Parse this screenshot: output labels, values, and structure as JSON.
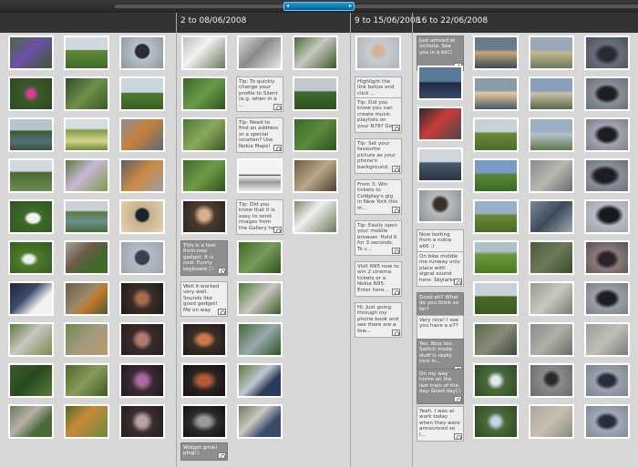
{
  "timeline": {
    "weeks": [
      {
        "label": "2 to 08/06/2008"
      },
      {
        "label": "9 to 15/06/2008"
      },
      {
        "label": "16 to 22/06/2008"
      }
    ],
    "scrubber": {
      "left_arrow": "◂",
      "right_arrow": "▸"
    }
  },
  "messages": {
    "w1": [
      "Tip: To quickly change your profile to Silent (e.g. when in a ...",
      "Tip: Need to find an address or a special location? Use Nokia Maps!",
      "Tip: Did you know that it is easy to send images from the Gallery to a ...",
      "This is a test from new gadget. It is cool. Funny keyboard ☐",
      "Well it worked very well. Sounds like good gadget! Me on way home fo...",
      "Widget gmail ping☐"
    ],
    "w2": [
      "Highlight the link below and click ...",
      "Tip: Did you know you can create music playlists on your N78? Go ...",
      "Tip: Set your favourite picture as your phone's background. Sele...",
      "From 3: Win tickets to Coldplay's gig in New York this m...",
      "Tip: Easily open your mobile browser. Hold 0 for 3 seconds. To c...",
      "Visit N95 now to win 2 cinema tickets or a Nokia N95. Enter here...",
      "Hi. Just going through my phone book and see there are a few..."
    ],
    "w3": [
      "Just arrived at victoria. See you in a bit☐",
      "Now texting from a nokia e66 :)",
      "On bike middle me runway only place with signal sound here. Skylarks sin...",
      "Good eh? What do you think so far?",
      "Very nice! I see you have a e7?",
      "Yes. Nice too. Switch mode stuff is really nice in...",
      "On my way home on the last train of the day. Good day☐",
      "Yeah. I was at work today when they were announced so I..."
    ]
  }
}
